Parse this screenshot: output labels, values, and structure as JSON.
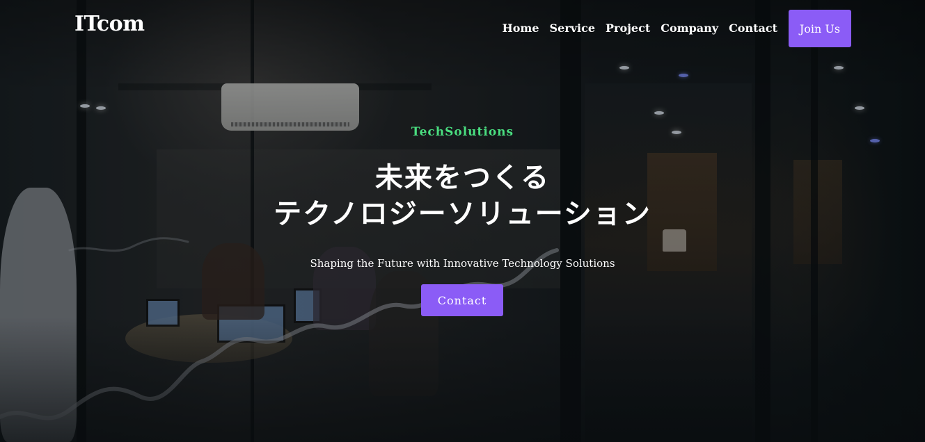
{
  "header": {
    "logo": "ITcom",
    "nav": [
      {
        "label": "Home"
      },
      {
        "label": "Service"
      },
      {
        "label": "Project"
      },
      {
        "label": "Company"
      },
      {
        "label": "Contact"
      }
    ],
    "join_label": "Join Us"
  },
  "hero": {
    "eyebrow": "TechSolutions",
    "headline_line1": "未来をつくる",
    "headline_line2": "テクノロジーソリューション",
    "subtitle": "Shaping the Future with Innovative Technology Solutions",
    "cta_label": "Contact"
  },
  "colors": {
    "accent": "#8b5cf6",
    "eyebrow": "#4ade80",
    "text": "#ffffff"
  }
}
